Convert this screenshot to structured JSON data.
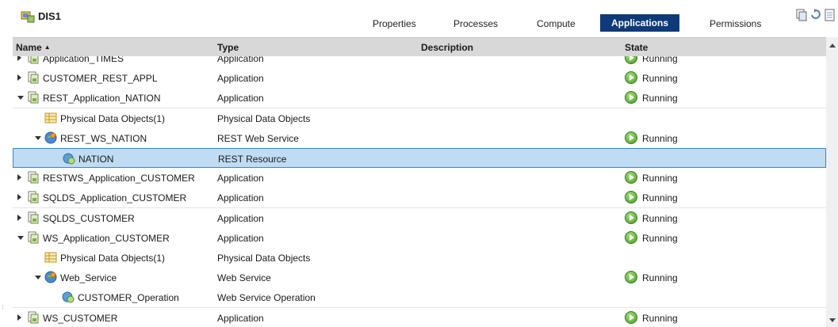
{
  "server": {
    "name": "DIS1"
  },
  "tabs": [
    {
      "label": "Properties",
      "active": false
    },
    {
      "label": "Processes",
      "active": false
    },
    {
      "label": "Compute",
      "active": false
    },
    {
      "label": "Applications",
      "active": true
    },
    {
      "label": "Permissions",
      "active": false
    }
  ],
  "toolbar": {
    "icons": [
      "deploy-icon",
      "refresh-icon",
      "export-icon"
    ]
  },
  "columns": {
    "name": "Name",
    "type": "Type",
    "description": "Description",
    "state": "State"
  },
  "colors": {
    "selected_row": "#bfdcf3",
    "active_tab": "#0d3a78",
    "header": "#d8d8d8",
    "running": "#4a9a2a"
  },
  "rows": [
    {
      "name": "Application_TIMES",
      "type": "Application",
      "state": "Running",
      "icon": "application-icon",
      "expander": "collapsed"
    },
    {
      "name": "CUSTOMER_REST_APPL",
      "type": "Application",
      "state": "Running",
      "icon": "application-icon",
      "expander": "collapsed"
    },
    {
      "name": "REST_Application_NATION",
      "type": "Application",
      "state": "Running",
      "icon": "application-icon",
      "expander": "expanded"
    },
    {
      "name": "Physical Data Objects(1)",
      "type": "Physical Data Objects",
      "state": "",
      "icon": "data-objects-icon",
      "expander": "none"
    },
    {
      "name": "REST_WS_NATION",
      "type": "REST Web Service",
      "state": "Running",
      "icon": "web-service-icon",
      "expander": "expanded"
    },
    {
      "name": "NATION",
      "type": "REST Resource",
      "state": "",
      "icon": "resource-icon",
      "expander": "none",
      "selected": true
    },
    {
      "name": "RESTWS_Application_CUSTOMER",
      "type": "Application",
      "state": "Running",
      "icon": "application-icon",
      "expander": "collapsed"
    },
    {
      "name": "SQLDS_Application_CUSTOMER",
      "type": "Application",
      "state": "Running",
      "icon": "application-icon",
      "expander": "collapsed"
    },
    {
      "name": "SQLDS_CUSTOMER",
      "type": "Application",
      "state": "Running",
      "icon": "application-icon",
      "expander": "collapsed"
    },
    {
      "name": "WS_Application_CUSTOMER",
      "type": "Application",
      "state": "Running",
      "icon": "application-icon",
      "expander": "expanded"
    },
    {
      "name": "Physical Data Objects(1)",
      "type": "Physical Data Objects",
      "state": "",
      "icon": "data-objects-icon",
      "expander": "none"
    },
    {
      "name": "Web_Service",
      "type": "Web Service",
      "state": "Running",
      "icon": "web-service-icon",
      "expander": "expanded"
    },
    {
      "name": "CUSTOMER_Operation",
      "type": "Web Service Operation",
      "state": "",
      "icon": "resource-icon",
      "expander": "none"
    },
    {
      "name": "WS_CUSTOMER",
      "type": "Application",
      "state": "Running",
      "icon": "application-icon",
      "expander": "collapsed"
    }
  ]
}
